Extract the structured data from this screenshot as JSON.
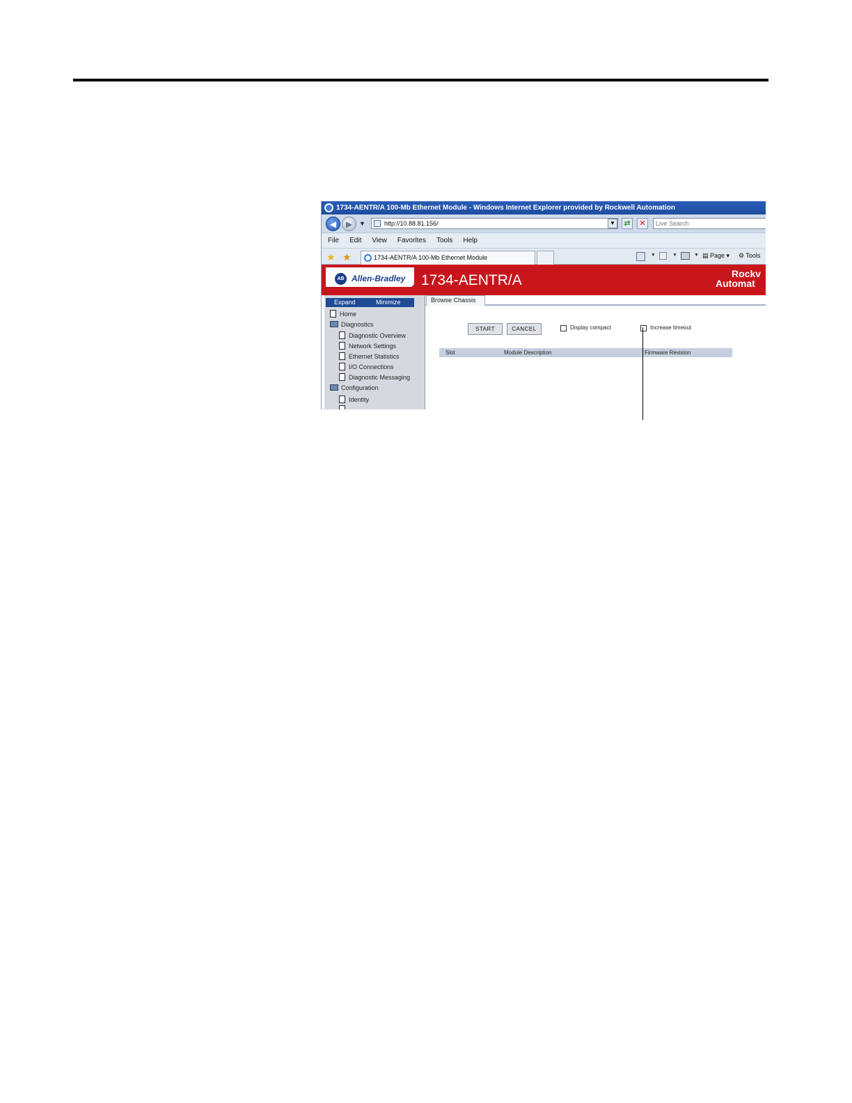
{
  "window": {
    "title": "1734-AENTR/A 100-Mb Ethernet Module - Windows Internet Explorer provided by Rockwell Automation"
  },
  "addressbar": {
    "url": "http://10.88.81.156/",
    "search_placeholder": "Live Search"
  },
  "menu": [
    "File",
    "Edit",
    "View",
    "Favorites",
    "Tools",
    "Help"
  ],
  "tab": {
    "label": "1734-AENTR/A 100-Mb Ethernet Module"
  },
  "commandbar": {
    "page_label": "Page",
    "tools_label": "Tools"
  },
  "banner": {
    "brand": "Allen-Bradley",
    "badge": "AB",
    "title": "1734-AENTR/A",
    "rockwell_line1": "Rockv",
    "rockwell_line2": "Automat"
  },
  "sidebar": {
    "expand_label": "Expand",
    "minimize_label": "Minimize",
    "items": [
      {
        "label": "Home",
        "type": "page",
        "level": 0
      },
      {
        "label": "Diagnostics",
        "type": "folder",
        "level": 0
      },
      {
        "label": "Diagnostic Overview",
        "type": "page",
        "level": 1
      },
      {
        "label": "Network Settings",
        "type": "page",
        "level": 1
      },
      {
        "label": "Ethernet Statistics",
        "type": "page",
        "level": 1
      },
      {
        "label": "I/O Connections",
        "type": "page",
        "level": 1
      },
      {
        "label": "Diagnostic Messaging",
        "type": "page",
        "level": 1
      },
      {
        "label": "Configuration",
        "type": "folder",
        "level": 0
      },
      {
        "label": "Identity",
        "type": "page",
        "level": 1
      }
    ]
  },
  "content": {
    "tab_label": "Browse Chassis",
    "start_label": "START",
    "cancel_label": "CANCEL",
    "display_compact_label": "Display compact",
    "increase_timeout_label": "Increase timeout",
    "columns": [
      "Slot",
      "Module Description",
      "Firmware Revision"
    ]
  }
}
